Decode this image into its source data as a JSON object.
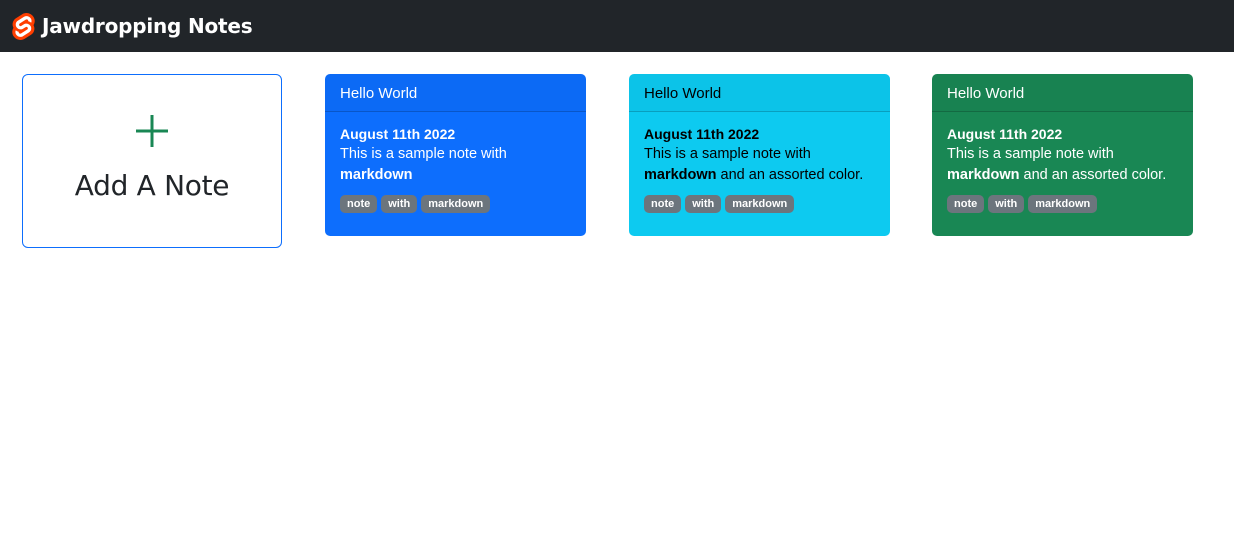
{
  "navbar": {
    "title": "Jawdropping Notes",
    "logo_icon": "svelte-logo-icon"
  },
  "add_card": {
    "label": "Add A Note",
    "icon": "plus-icon",
    "icon_color": "#198754"
  },
  "notes": [
    {
      "title": "Hello World",
      "date": "August 11th 2022",
      "text_plain": "This is a sample note with ",
      "text_bold": "markdown",
      "text_after": "",
      "tags": [
        "note",
        "with",
        "markdown"
      ],
      "color": "#0d6efd",
      "text_color": "#ffffff"
    },
    {
      "title": "Hello World",
      "date": "August 11th 2022",
      "text_plain": "This is a sample note with ",
      "text_bold": "markdown",
      "text_after": " and an assorted color.",
      "tags": [
        "note",
        "with",
        "markdown"
      ],
      "color": "#0dcaf0",
      "text_color": "#000000"
    },
    {
      "title": "Hello World",
      "date": "August 11th 2022",
      "text_plain": "This is a sample note with ",
      "text_bold": "markdown",
      "text_after": " and an assorted color.",
      "tags": [
        "note",
        "with",
        "markdown"
      ],
      "color": "#198754",
      "text_color": "#ffffff"
    }
  ]
}
